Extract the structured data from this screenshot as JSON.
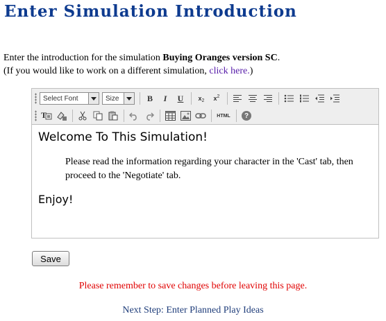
{
  "page": {
    "title": "Enter Simulation Introduction",
    "intro_prefix": "Enter the introduction for the simulation ",
    "simulation_name": "Buying Oranges version SC",
    "intro_suffix": ".",
    "switch_prefix": "(If you would like to work on a different simulation, ",
    "switch_link": "click here.",
    "switch_suffix": ")"
  },
  "editor": {
    "toolbar": {
      "font_select": "Select Font",
      "size_select": "Size",
      "bold": "B",
      "italic": "I",
      "underline": "U",
      "subscript": "x",
      "superscript": "x",
      "html_button": "HTML",
      "help_button": "?"
    },
    "content": {
      "heading": "Welcome To This Simulation!",
      "paragraph": "Please read the information regarding your character in the 'Cast' tab, then proceed to the 'Negotiate' tab.",
      "closing": "Enjoy!"
    }
  },
  "actions": {
    "save_label": "Save",
    "warning": "Please remember to save changes before leaving this page.",
    "next_step": "Next Step: Enter Planned Play Ideas"
  },
  "colors": {
    "title": "#0e3b8f",
    "link": "#551aa8",
    "warning": "#e00000",
    "next_step": "#1f3d7a"
  }
}
